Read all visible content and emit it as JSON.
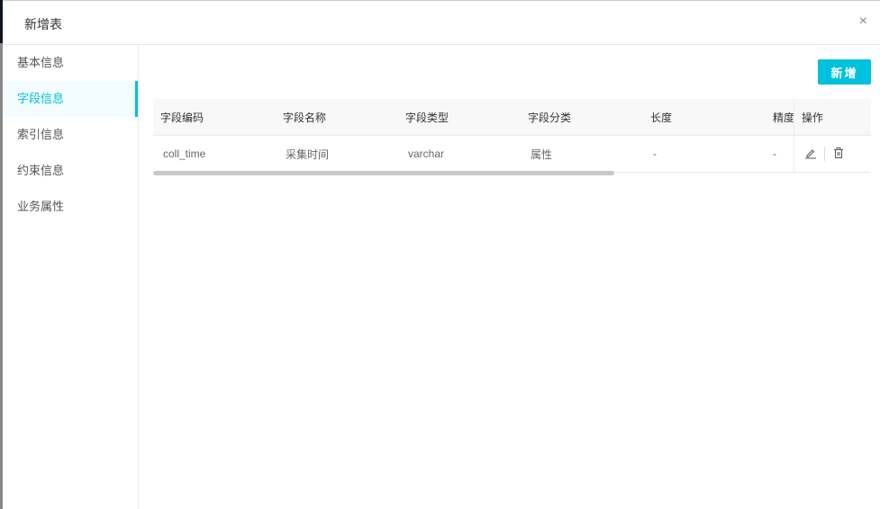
{
  "dialog": {
    "title": "新增表",
    "close_icon": "×"
  },
  "sidebar": {
    "items": [
      {
        "label": "基本信息"
      },
      {
        "label": "字段信息"
      },
      {
        "label": "索引信息"
      },
      {
        "label": "约束信息"
      },
      {
        "label": "业务属性"
      }
    ]
  },
  "toolbar": {
    "add_label": "新增"
  },
  "table": {
    "headers": [
      "字段编码",
      "字段名称",
      "字段类型",
      "字段分类",
      "长度",
      "精度",
      "操作"
    ],
    "rows": [
      {
        "cells": [
          "coll_time",
          "采集时间",
          "varchar",
          "属性",
          "-",
          "-"
        ]
      }
    ]
  },
  "colors": {
    "accent": "#00c1de"
  }
}
